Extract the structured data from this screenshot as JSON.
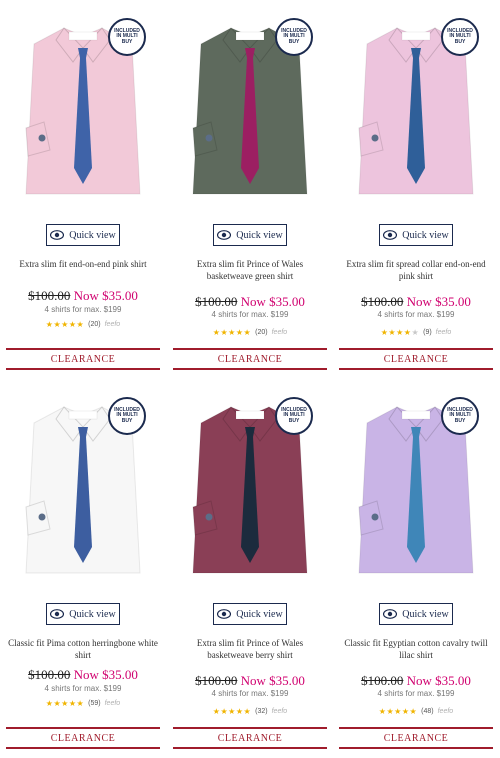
{
  "products": [
    {
      "badge": "INCLUDED IN MULTI BUY",
      "quick_view": "Quick view",
      "name": "Extra slim fit end-on-end pink shirt",
      "was_price": "$100.00",
      "now_price": "Now $35.00",
      "multi_buy": "4 shirts for max. $199",
      "rating": 4.5,
      "stars": "★★★★★",
      "review_count": "(20)",
      "review_brand": "feefo",
      "clearance": "CLEARANCE",
      "shirt_color": "#f2c9d8",
      "tie_color": "#3f63a8"
    },
    {
      "badge": "INCLUDED IN MULTI BUY",
      "quick_view": "Quick view",
      "name": "Extra slim fit Prince of Wales basketweave green shirt",
      "was_price": "$100.00",
      "now_price": "Now $35.00",
      "multi_buy": "4 shirts for max. $199",
      "rating": 5,
      "stars": "★★★★★",
      "review_count": "(20)",
      "review_brand": "feefo",
      "clearance": "CLEARANCE",
      "shirt_color": "#5e6a5d",
      "tie_color": "#9c1f62"
    },
    {
      "badge": "INCLUDED IN MULTI BUY",
      "quick_view": "Quick view",
      "name": "Extra slim fit spread collar end-on-end pink shirt",
      "was_price": "$100.00",
      "now_price": "Now $35.00",
      "multi_buy": "4 shirts for max. $199",
      "rating": 4,
      "stars": "★★★★★",
      "review_count": "(9)",
      "review_brand": "feefo",
      "clearance": "CLEARANCE",
      "shirt_color": "#edc4dd",
      "tie_color": "#2f5f99"
    },
    {
      "badge": "INCLUDED IN MULTI BUY",
      "quick_view": "Quick view",
      "name": "Classic fit Pima cotton herringbone white shirt",
      "was_price": "$100.00",
      "now_price": "Now $35.00",
      "multi_buy": "4 shirts for max. $199",
      "rating": 4.5,
      "stars": "★★★★★",
      "review_count": "(59)",
      "review_brand": "feefo",
      "clearance": "CLEARANCE",
      "shirt_color": "#f7f7f7",
      "tie_color": "#3d5ea0"
    },
    {
      "badge": "INCLUDED IN MULTI BUY",
      "quick_view": "Quick view",
      "name": "Extra slim fit Prince of Wales basketweave berry shirt",
      "was_price": "$100.00",
      "now_price": "Now $35.00",
      "multi_buy": "4 shirts for max. $199",
      "rating": 5,
      "stars": "★★★★★",
      "review_count": "(32)",
      "review_brand": "feefo",
      "clearance": "CLEARANCE",
      "shirt_color": "#8a3f56",
      "tie_color": "#1c2b3d"
    },
    {
      "badge": "INCLUDED IN MULTI BUY",
      "quick_view": "Quick view",
      "name": "Classic fit Egyptian cotton cavalry twill lilac shirt",
      "was_price": "$100.00",
      "now_price": "Now $35.00",
      "multi_buy": "4 shirts for max. $199",
      "rating": 5,
      "stars": "★★★★★",
      "review_count": "(48)",
      "review_brand": "feefo",
      "clearance": "CLEARANCE",
      "shirt_color": "#c9b4e6",
      "tie_color": "#3f86b8"
    }
  ],
  "colors": {
    "navy": "#1b2a4e",
    "sale_pink": "#d0006f",
    "clearance_red": "#a01c2c",
    "star_gold": "#f0b400"
  }
}
